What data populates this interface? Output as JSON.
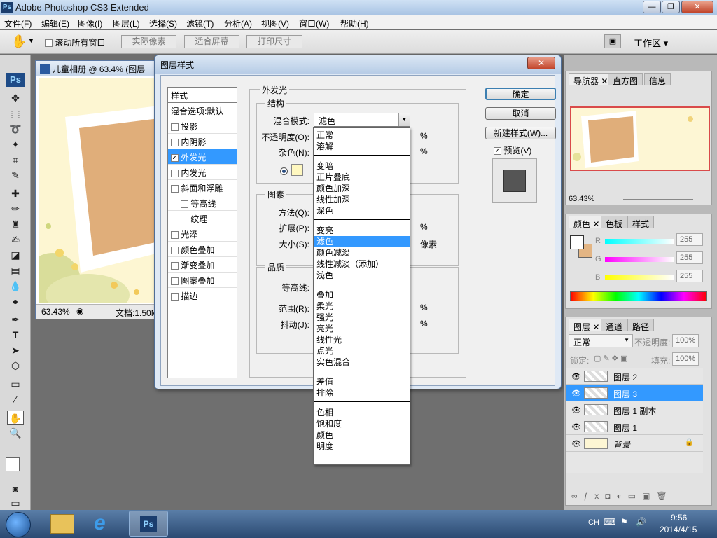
{
  "app": {
    "title": "Adobe Photoshop CS3 Extended",
    "ps_logo": "Ps"
  },
  "window_controls": {
    "minimize": "—",
    "restore": "❐",
    "close": "✕"
  },
  "menubar": [
    "文件(F)",
    "编辑(E)",
    "图像(I)",
    "图层(L)",
    "选择(S)",
    "滤镜(T)",
    "分析(A)",
    "视图(V)",
    "窗口(W)",
    "帮助(H)"
  ],
  "optionsbar": {
    "scroll_all": "滚动所有窗口",
    "actual_pixels": "实际像素",
    "fit_screen": "适合屏幕",
    "print_size": "打印尺寸",
    "workspace": "工作区 ▾"
  },
  "document": {
    "title": "儿童相册 @ 63.4% (图层",
    "zoom": "63.43%",
    "docinfo": "文档:1.50M"
  },
  "dialog": {
    "title": "图层样式",
    "close": "✕",
    "styles_header": "样式",
    "styles": [
      {
        "label": "混合选项:默认",
        "checkbox": false,
        "checked": false,
        "selected": false,
        "indent": false
      },
      {
        "label": "投影",
        "checkbox": true,
        "checked": false,
        "selected": false,
        "indent": false
      },
      {
        "label": "内阴影",
        "checkbox": true,
        "checked": false,
        "selected": false,
        "indent": false
      },
      {
        "label": "外发光",
        "checkbox": true,
        "checked": true,
        "selected": true,
        "indent": false
      },
      {
        "label": "内发光",
        "checkbox": true,
        "checked": false,
        "selected": false,
        "indent": false
      },
      {
        "label": "斜面和浮雕",
        "checkbox": true,
        "checked": false,
        "selected": false,
        "indent": false
      },
      {
        "label": "等高线",
        "checkbox": true,
        "checked": false,
        "selected": false,
        "indent": true
      },
      {
        "label": "纹理",
        "checkbox": true,
        "checked": false,
        "selected": false,
        "indent": true
      },
      {
        "label": "光泽",
        "checkbox": true,
        "checked": false,
        "selected": false,
        "indent": false
      },
      {
        "label": "颜色叠加",
        "checkbox": true,
        "checked": false,
        "selected": false,
        "indent": false
      },
      {
        "label": "渐变叠加",
        "checkbox": true,
        "checked": false,
        "selected": false,
        "indent": false
      },
      {
        "label": "图案叠加",
        "checkbox": true,
        "checked": false,
        "selected": false,
        "indent": false
      },
      {
        "label": "描边",
        "checkbox": true,
        "checked": false,
        "selected": false,
        "indent": false
      }
    ],
    "outer_glow": "外发光",
    "structure": "结构",
    "blend_mode_label": "混合模式:",
    "blend_mode_value": "滤色",
    "opacity_label": "不透明度(O):",
    "noise_label": "杂色(N):",
    "percent": "%",
    "elements": "图素",
    "method_label": "方法(Q):",
    "spread_label": "扩展(P):",
    "size_label": "大小(S):",
    "pixels": "像素",
    "quality": "品质",
    "contour_label": "等高线:",
    "range_label": "范围(R):",
    "jitter_label": "抖动(J):",
    "ok": "确定",
    "cancel": "取消",
    "new_style": "新建样式(W)...",
    "preview": "预览(V)",
    "glow_color": "#fff8c0"
  },
  "blend_dropdown": {
    "groups": [
      [
        "正常",
        "溶解"
      ],
      [
        "变暗",
        "正片叠底",
        "颜色加深",
        "线性加深",
        "深色"
      ],
      [
        "变亮",
        "滤色",
        "颜色减淡",
        "线性减淡（添加）",
        "浅色"
      ],
      [
        "叠加",
        "柔光",
        "强光",
        "亮光",
        "线性光",
        "点光",
        "实色混合"
      ],
      [
        "差值",
        "排除"
      ],
      [
        "色相",
        "饱和度",
        "颜色",
        "明度"
      ]
    ],
    "selected": "滤色"
  },
  "navigator": {
    "tabs": [
      "导航器",
      "直方图",
      "信息"
    ],
    "zoom": "63.43%"
  },
  "color_panel": {
    "tabs": [
      "颜色",
      "色板",
      "样式"
    ],
    "r_label": "R",
    "g_label": "G",
    "b_label": "B",
    "r": "255",
    "g": "255",
    "b": "255"
  },
  "layers_panel": {
    "tabs": [
      "图层",
      "通道",
      "路径"
    ],
    "blend": "正常",
    "opacity_label": "不透明度:",
    "opacity": "100%",
    "lock_label": "锁定:",
    "fill_label": "填充:",
    "fill": "100%",
    "layers": [
      {
        "name": "图层 2",
        "selected": false
      },
      {
        "name": "图层 3",
        "selected": true
      },
      {
        "name": "图层 1 副本",
        "selected": false
      },
      {
        "name": "图层 1",
        "selected": false
      },
      {
        "name": "背景",
        "selected": false
      }
    ]
  },
  "taskbar": {
    "lang": "CH",
    "time": "9:56",
    "date": "2014/4/15",
    "ps": "Ps",
    "ie": "e"
  }
}
